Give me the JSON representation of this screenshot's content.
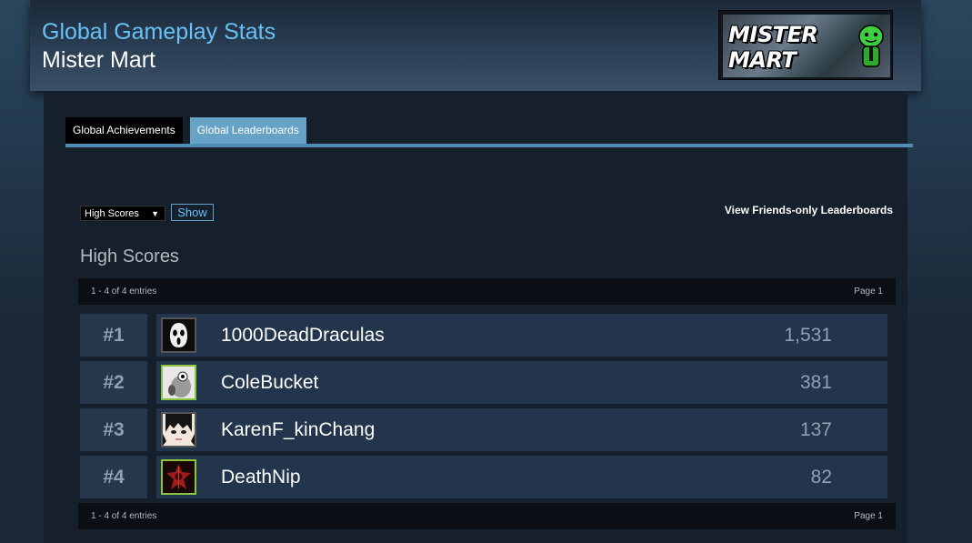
{
  "header": {
    "title": "Global Gameplay Stats",
    "game_name": "Mister Mart",
    "logo_text": "MISTER MART"
  },
  "tabs": [
    {
      "label": "Global Achievements",
      "active": false
    },
    {
      "label": "Global Leaderboards",
      "active": true
    }
  ],
  "filter": {
    "selected": "High Scores",
    "show_label": "Show"
  },
  "friends_link": "View Friends-only Leaderboards",
  "leaderboard": {
    "title": "High Scores",
    "entries_summary": "1 - 4 of 4 entries",
    "page_label": "Page 1",
    "rows": [
      {
        "rank": "#1",
        "name": "1000DeadDraculas",
        "score": "1,531",
        "avatar": "ghost-mask-avatar"
      },
      {
        "rank": "#2",
        "name": "ColeBucket",
        "score": "381",
        "avatar": "cartoon-animal-avatar"
      },
      {
        "rank": "#3",
        "name": "KarenF_kinChang",
        "score": "137",
        "avatar": "anime-face-avatar"
      },
      {
        "rank": "#4",
        "name": "DeathNip",
        "score": "82",
        "avatar": "red-emblem-avatar"
      }
    ]
  },
  "colors": {
    "accent": "#67c1f5",
    "tab_active": "#67a3c7",
    "row_bg": "#23354c",
    "rank_bg": "#27374b"
  }
}
